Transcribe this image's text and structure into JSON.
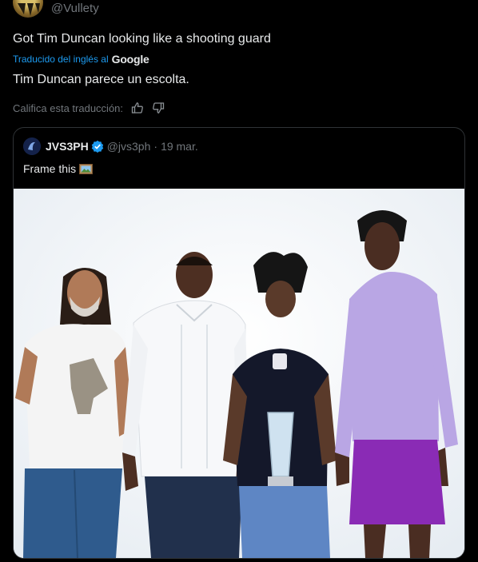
{
  "header": {
    "handle": "@Vullety"
  },
  "tweet": {
    "text": "Got Tim Duncan looking like a shooting guard",
    "translated_label": "Traducido del inglés al",
    "translator_brand": "Google",
    "translation": "Tim Duncan parece un escolta.",
    "rate_label": "Califica esta traducción:"
  },
  "quote": {
    "name": "JVS3PH",
    "handle": "@jvs3ph",
    "separator": "·",
    "date": "19 mar.",
    "text": "Frame this",
    "verified_color": "#1d9bf0"
  },
  "icons": {
    "rate_up": "thumbs-up-icon",
    "rate_down": "thumbs-down-icon",
    "verified": "verified-badge-icon",
    "frame": "framed-picture-icon"
  },
  "colors": {
    "background": "#000000",
    "text": "#e7e9ea",
    "muted": "#71767b",
    "link": "#1d9bf0",
    "border": "#2f3336"
  }
}
